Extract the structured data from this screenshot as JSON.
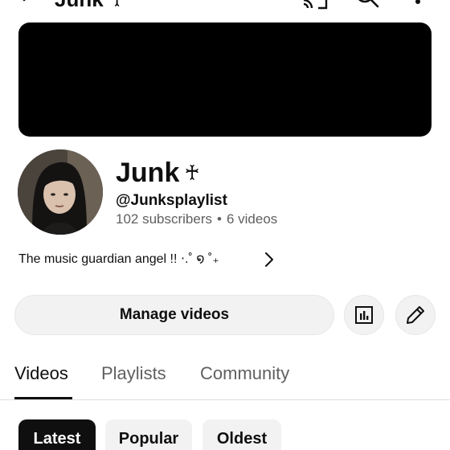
{
  "topbar": {
    "title": "Junk ♰"
  },
  "channel": {
    "name": "Junk",
    "name_symbol": "♰",
    "handle": "@Junksplaylist",
    "subscribers": "102 subscribers",
    "separator": "•",
    "videos": "6 videos",
    "description": "The music guardian angel !! ⋅.˚ ໑ ˚₊"
  },
  "actions": {
    "manage_label": "Manage videos"
  },
  "tabs": [
    {
      "label": "Videos",
      "active": true
    },
    {
      "label": "Playlists",
      "active": false
    },
    {
      "label": "Community",
      "active": false
    }
  ],
  "chips": [
    {
      "label": "Latest",
      "active": true
    },
    {
      "label": "Popular",
      "active": false
    },
    {
      "label": "Oldest",
      "active": false
    }
  ],
  "icons": {
    "back": "back-arrow-icon",
    "cast": "cast-icon",
    "search": "search-icon",
    "more": "more-vert-icon",
    "description_more": "chevron-right-icon",
    "analytics": "analytics-icon",
    "edit": "edit-pencil-icon"
  },
  "colors": {
    "text": "#0f0f0f",
    "secondary_text": "#606060",
    "surface": "#f2f2f2",
    "banner": "#000000"
  }
}
